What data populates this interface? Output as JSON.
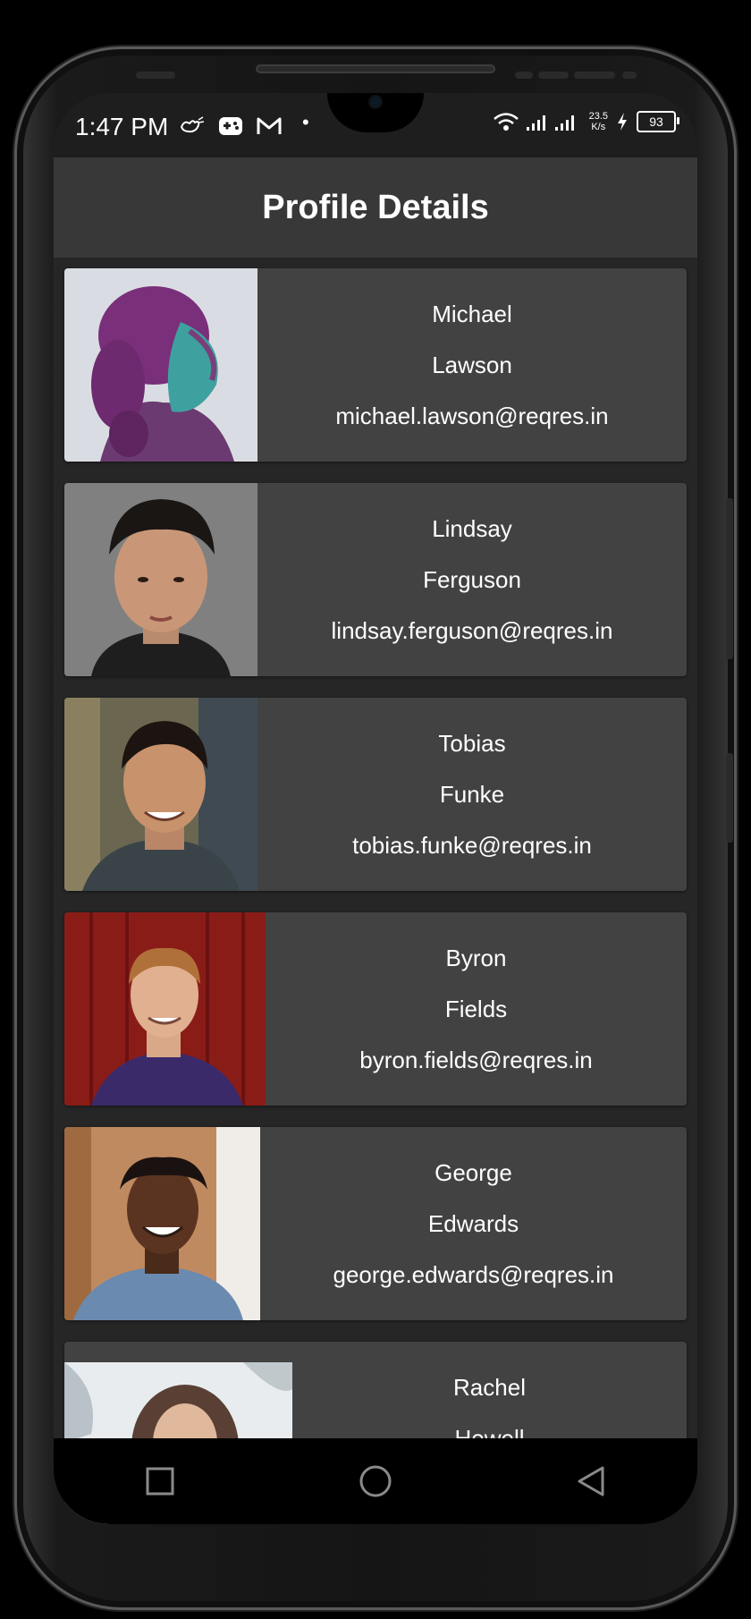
{
  "status_bar": {
    "time": "1:47 PM",
    "net_speed_value": "23.5",
    "net_speed_unit": "K/s",
    "battery": "93"
  },
  "app_bar": {
    "title": "Profile Details"
  },
  "profiles": [
    {
      "first_name": "Michael",
      "last_name": "Lawson",
      "email": "michael.lawson@reqres.in"
    },
    {
      "first_name": "Lindsay",
      "last_name": "Ferguson",
      "email": "lindsay.ferguson@reqres.in"
    },
    {
      "first_name": "Tobias",
      "last_name": "Funke",
      "email": "tobias.funke@reqres.in"
    },
    {
      "first_name": "Byron",
      "last_name": "Fields",
      "email": "byron.fields@reqres.in"
    },
    {
      "first_name": "George",
      "last_name": "Edwards",
      "email": "george.edwards@reqres.in"
    },
    {
      "first_name": "Rachel",
      "last_name": "Howell",
      "email": ""
    }
  ],
  "nav_bar": {
    "items": [
      "recents-icon",
      "home-icon",
      "back-icon"
    ]
  },
  "colors": {
    "card": "#424242",
    "app_bar": "#383838",
    "background": "#262626",
    "text": "#ffffff"
  }
}
